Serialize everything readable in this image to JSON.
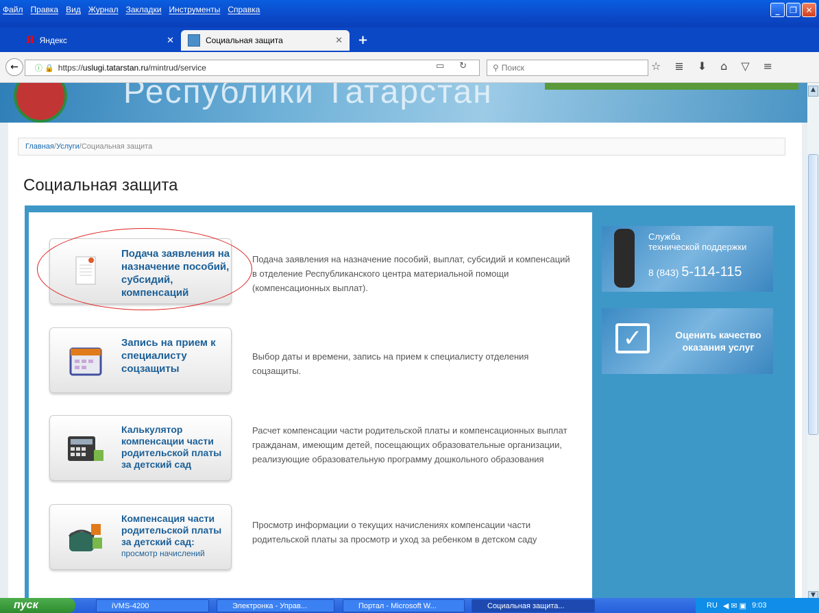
{
  "menu": [
    "Файл",
    "Правка",
    "Вид",
    "Журнал",
    "Закладки",
    "Инструменты",
    "Справка"
  ],
  "tabs": [
    {
      "label": "Яндекс"
    },
    {
      "label": "Социальная защита"
    }
  ],
  "url": {
    "prefix": "https://",
    "host": "uslugi.tatarstan.ru",
    "path": "/mintrud/service"
  },
  "search_placeholder": "Поиск",
  "banner_title": "Республики Татарстан",
  "breadcrumb": {
    "home": "Главная",
    "services": "Услуги",
    "current": "Социальная защита",
    "sep": " / "
  },
  "page_title": "Социальная защита",
  "services": [
    {
      "label": "Подача заявления на назначение пособий, субсидий, компенсаций",
      "desc": "Подача заявления на назначение пособий, выплат, субсидий и компенсаций в отделение Республиканского центра материальной помощи (компенсационных выплат)."
    },
    {
      "label": "Запись на прием к специалисту соцзащиты",
      "desc": "Выбор даты и времени, запись на прием к специалисту отделения соцзащиты."
    },
    {
      "label": "Калькулятор компенсации части родительской платы за детский сад",
      "desc": "Расчет компенсации части родительской платы и компенсационных выплат гражданам, имеющим детей, посещающих образовательные организации, реализующие образовательную программу дошкольного образования"
    },
    {
      "label": "Компенсация части родительской платы за детский сад:",
      "sub": "просмотр начислений",
      "desc": "Просмотр информации о текущих начислениях компенсации части родительской платы за просмотр и уход за ребенком в детском саду"
    }
  ],
  "support": {
    "line1": "Служба",
    "line2": "технической поддержки",
    "code": "8 (843)",
    "number": "5-114-115"
  },
  "rate": {
    "label": "Оценить качество оказания услуг"
  },
  "taskbar": {
    "start": "пуск",
    "tasks": [
      "iVMS-4200",
      "Электронка - Управ...",
      "Портал - Microsoft W...",
      "Социальная защита..."
    ],
    "lang": "RU",
    "time": "9:03"
  }
}
